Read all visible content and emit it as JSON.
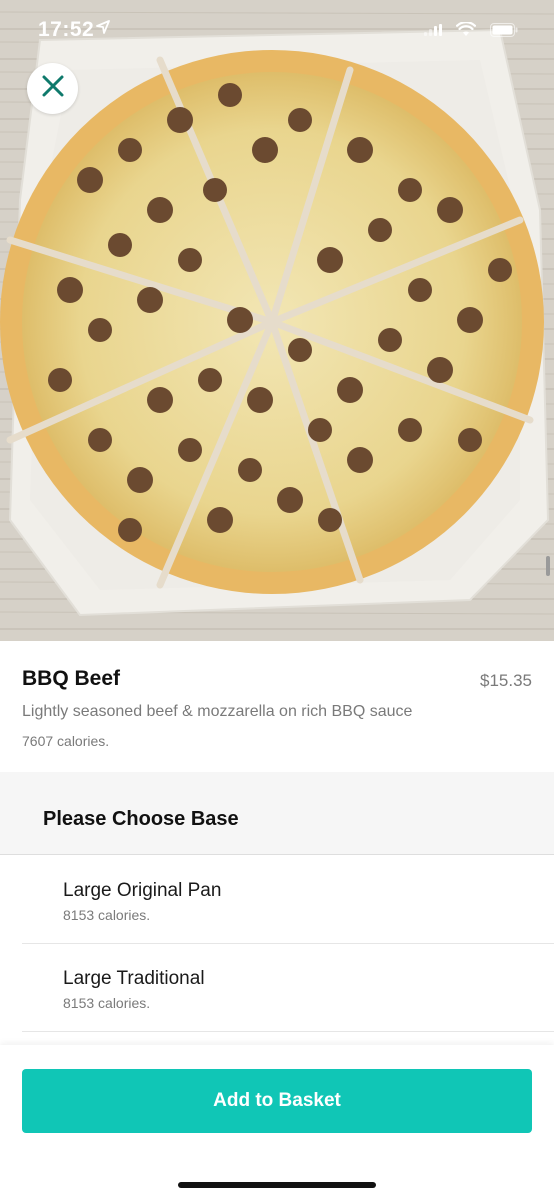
{
  "status_bar": {
    "time": "17:52",
    "icons": [
      "location-arrow-icon",
      "signal-icon",
      "wifi-icon",
      "battery-icon"
    ]
  },
  "hero": {
    "image": "pizza-photo",
    "close_icon": "close-icon"
  },
  "product": {
    "name": "BBQ Beef",
    "price": "$15.35",
    "description": "Lightly seasoned beef & mozzarella on rich BBQ sauce",
    "calories": "7607 calories."
  },
  "section": {
    "title": "Please Choose Base"
  },
  "options": [
    {
      "name": "Large Original Pan",
      "calories": "8153 calories."
    },
    {
      "name": "Large Traditional",
      "calories": "8153 calories."
    }
  ],
  "actions": {
    "add_to_basket": "Add to Basket"
  },
  "colors": {
    "accent": "#10c6b6",
    "close_icon": "#0f7a6c"
  }
}
